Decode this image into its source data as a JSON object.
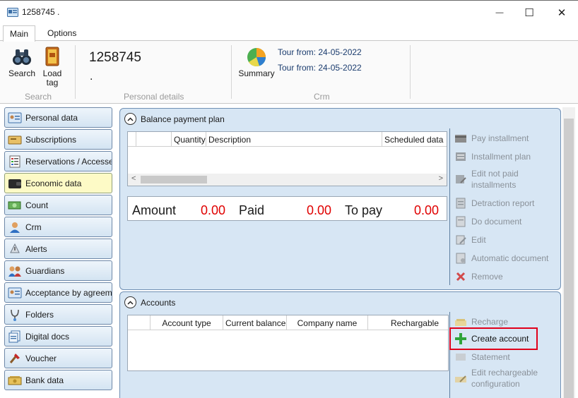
{
  "window": {
    "title": "1258745 .",
    "minimize_glyph": "—",
    "maximize_glyph": "☐",
    "close_glyph": "✕"
  },
  "tabs": [
    {
      "label": "Main",
      "active": true
    },
    {
      "label": "Options",
      "active": false
    }
  ],
  "ribbon": {
    "search_label": "Search",
    "load_tag_label_1": "Load",
    "load_tag_label_2": "tag",
    "group_search": "Search",
    "personal_id": "1258745",
    "personal_sub": ".",
    "group_personal": "Personal details",
    "summary_label": "Summary",
    "tour_1": "Tour from: 24-05-2022",
    "tour_2": "Tour from: 24-05-2022",
    "group_crm": "Crm"
  },
  "nav": [
    {
      "label": "Personal data",
      "icon": "id-card-icon"
    },
    {
      "label": "Subscriptions",
      "icon": "ticket-icon"
    },
    {
      "label": "Reservations / Accesses",
      "icon": "checklist-icon"
    },
    {
      "label": "Economic data",
      "icon": "wallet-icon",
      "active": true
    },
    {
      "label": "Count",
      "icon": "money-icon"
    },
    {
      "label": "Crm",
      "icon": "person-icon"
    },
    {
      "label": "Alerts",
      "icon": "alert-icon"
    },
    {
      "label": "Guardians",
      "icon": "guardians-icon"
    },
    {
      "label": "Acceptance by agreement",
      "icon": "agreement-icon"
    },
    {
      "label": "Folders",
      "icon": "stethoscope-icon"
    },
    {
      "label": "Digital docs",
      "icon": "documents-icon"
    },
    {
      "label": "Voucher",
      "icon": "voucher-icon"
    },
    {
      "label": "Bank data",
      "icon": "bank-icon"
    }
  ],
  "balance_panel": {
    "title": "Balance payment plan",
    "columns": [
      "",
      "",
      "Quantity",
      "Description",
      "Scheduled data"
    ],
    "totals": {
      "amount_label": "Amount",
      "amount_value": "0.00",
      "paid_label": "Paid",
      "paid_value": "0.00",
      "topay_label": "To pay",
      "topay_value": "0.00"
    },
    "actions": [
      {
        "label": "Pay installment",
        "icon": "pay-icon"
      },
      {
        "label": "Installment plan",
        "icon": "plan-icon"
      },
      {
        "label": "Edit not paid",
        "label2": "installments",
        "icon": "edit-installments-icon"
      },
      {
        "label": "Detraction report",
        "icon": "report-icon"
      },
      {
        "label": "Do document",
        "icon": "document-icon"
      },
      {
        "label": "Edit",
        "icon": "edit-icon"
      },
      {
        "label": "Automatic document",
        "icon": "auto-document-icon"
      },
      {
        "label": "Remove",
        "icon": "remove-icon"
      }
    ]
  },
  "accounts_panel": {
    "title": "Accounts",
    "columns": [
      "",
      "Account type",
      "Current balance",
      "Company name",
      "Rechargable"
    ],
    "actions": [
      {
        "label": "Recharge",
        "icon": "recharge-icon",
        "enabled": false
      },
      {
        "label": "Create account",
        "icon": "plus-icon",
        "enabled": true,
        "highlighted": true
      },
      {
        "label": "Statement",
        "icon": "statement-icon",
        "enabled": false
      },
      {
        "label": "Edit rechargeable",
        "label2": "configuration",
        "icon": "edit-recharge-icon",
        "enabled": false
      }
    ]
  },
  "colors": {
    "accent_red": "#e00000",
    "highlight_border": "#e0001b",
    "panel_bg": "#d7e6f4",
    "active_nav": "#fdfac6"
  }
}
